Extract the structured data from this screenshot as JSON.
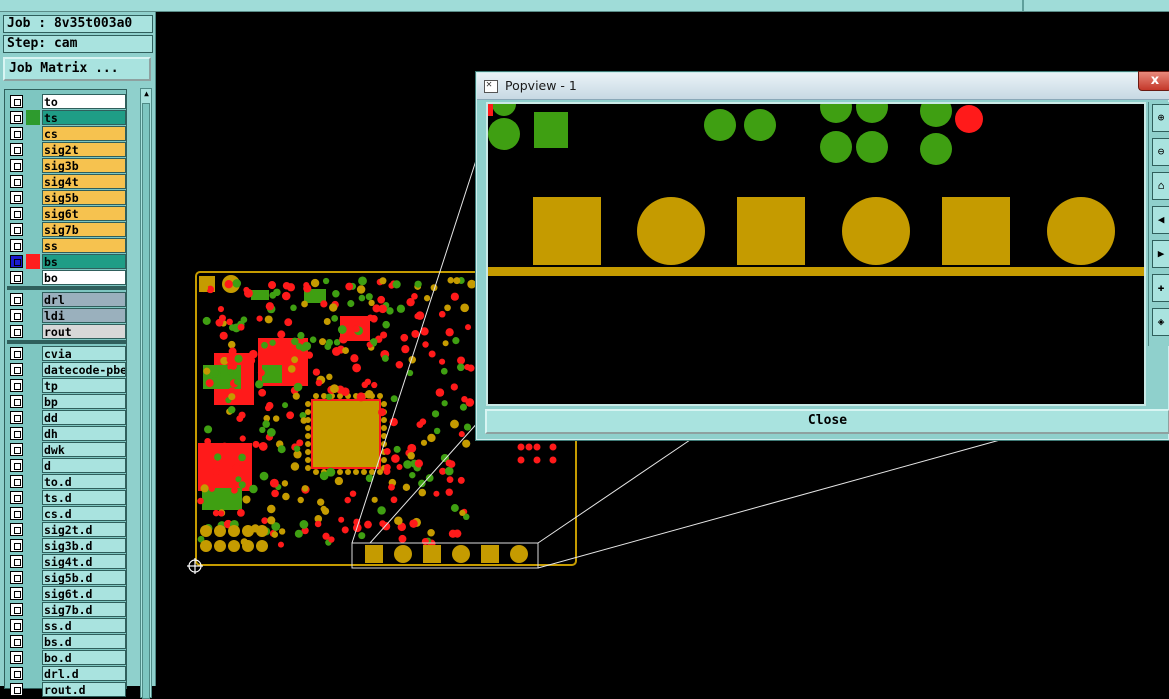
{
  "job_label": "Job : 8v35t003a0",
  "step_label": "Step: cam",
  "matrix_button": "Job Matrix ...",
  "popview": {
    "title": "Popview - 1",
    "close_x": "x",
    "close_button": "Close"
  },
  "layers_group1": [
    {
      "name": "to",
      "bg": "#ffffff",
      "swatch": ""
    },
    {
      "name": "ts",
      "bg": "#1f9d86",
      "swatch": "#2e9b2e"
    },
    {
      "name": "cs",
      "bg": "#f6c24f",
      "swatch": ""
    },
    {
      "name": "sig2t",
      "bg": "#f6c24f",
      "swatch": ""
    },
    {
      "name": "sig3b",
      "bg": "#f6c24f",
      "swatch": ""
    },
    {
      "name": "sig4t",
      "bg": "#f6c24f",
      "swatch": ""
    },
    {
      "name": "sig5b",
      "bg": "#f6c24f",
      "swatch": ""
    },
    {
      "name": "sig6t",
      "bg": "#f6c24f",
      "swatch": ""
    },
    {
      "name": "sig7b",
      "bg": "#f6c24f",
      "swatch": ""
    },
    {
      "name": "ss",
      "bg": "#f6c24f",
      "swatch": ""
    },
    {
      "name": "bs",
      "bg": "#1f9d86",
      "swatch": "#ff1e1e",
      "selected": true
    },
    {
      "name": "bo",
      "bg": "#ffffff",
      "swatch": ""
    }
  ],
  "layers_group2": [
    {
      "name": "drl",
      "bg": "#9ab0bd"
    },
    {
      "name": "ldi",
      "bg": "#9ab0bd"
    },
    {
      "name": "rout",
      "bg": "#d8d8d8"
    }
  ],
  "layers_group3": [
    {
      "name": "cvia"
    },
    {
      "name": "datecode-pbe"
    },
    {
      "name": "tp"
    },
    {
      "name": "bp"
    },
    {
      "name": "dd"
    },
    {
      "name": "dh"
    },
    {
      "name": "dwk"
    },
    {
      "name": "d"
    },
    {
      "name": "to.d"
    },
    {
      "name": "ts.d"
    },
    {
      "name": "cs.d"
    },
    {
      "name": "sig2t.d"
    },
    {
      "name": "sig3b.d"
    },
    {
      "name": "sig4t.d"
    },
    {
      "name": "sig5b.d"
    },
    {
      "name": "sig6t.d"
    },
    {
      "name": "sig7b.d"
    },
    {
      "name": "ss.d"
    },
    {
      "name": "bs.d"
    },
    {
      "name": "bo.d"
    },
    {
      "name": "drl.d"
    },
    {
      "name": "rout.d"
    }
  ],
  "colors": {
    "gold": "#c59b00",
    "green": "#3f9f12",
    "red": "#ff1a1a",
    "panel": "#8fd0cc"
  }
}
